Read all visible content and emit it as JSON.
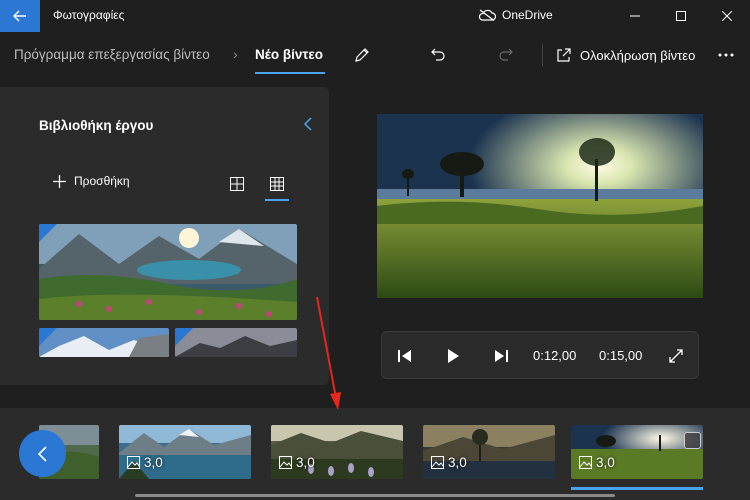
{
  "titlebar": {
    "app_title": "Φωτογραφίες",
    "cloud_label": "OneDrive"
  },
  "toolbar": {
    "breadcrumb_parent": "Πρόγραμμα επεξεργασίας βίντεο",
    "breadcrumb_current": "Νέο βίντεο",
    "finish_label": "Ολοκλήρωση βίντεο"
  },
  "library": {
    "title": "Βιβλιοθήκη έργου",
    "add_label": "Προσθήκη"
  },
  "player": {
    "current_time": "0:12,00",
    "total_time": "0:15,00"
  },
  "storyboard": {
    "clips": [
      {
        "duration": "3,0"
      },
      {
        "duration": "3,0"
      },
      {
        "duration": "3,0"
      },
      {
        "duration": "3,0"
      }
    ],
    "selected_clip_index": 3
  },
  "colors": {
    "accent": "#2b78d4",
    "accent_light": "#4aa3f0",
    "annotation_arrow": "#e8261c"
  }
}
